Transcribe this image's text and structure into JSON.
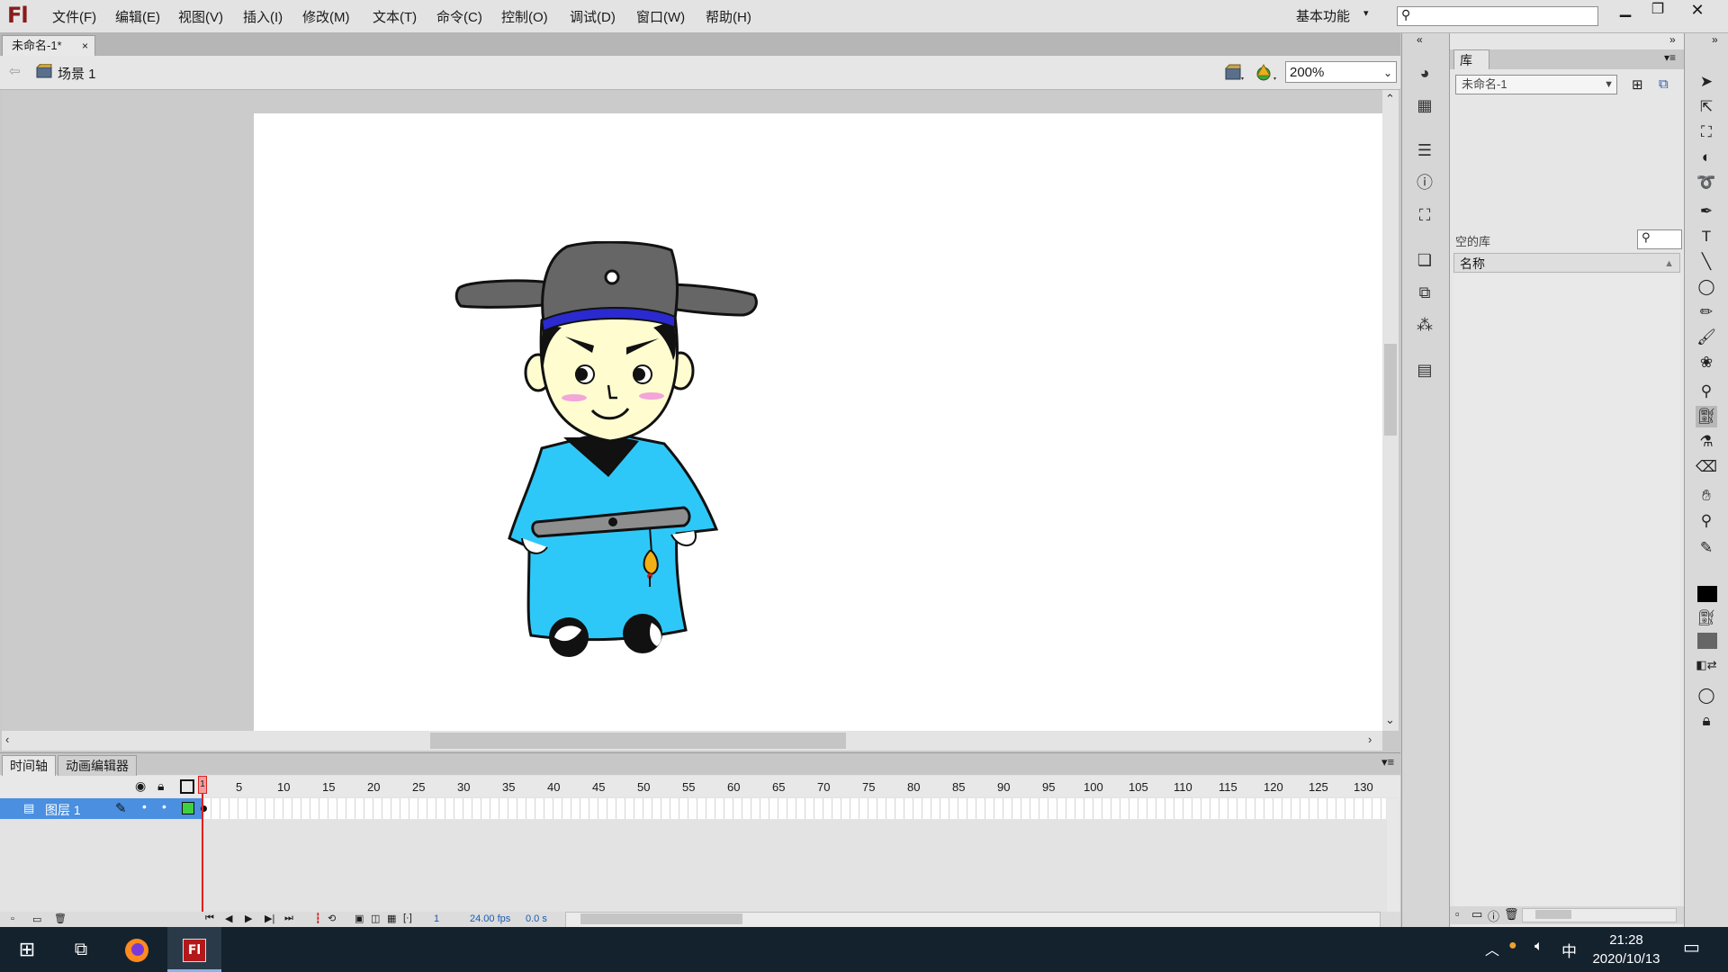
{
  "app": {
    "logo": "Fl",
    "workspace": "基本功能",
    "search_placeholder": ""
  },
  "menu": [
    "文件(F)",
    "编辑(E)",
    "视图(V)",
    "插入(I)",
    "修改(M)",
    "文本(T)",
    "命令(C)",
    "控制(O)",
    "调试(D)",
    "窗口(W)",
    "帮助(H)"
  ],
  "document": {
    "tab_title": "未命名-1*",
    "close": "×",
    "scene": "场景 1",
    "zoom": "200%"
  },
  "timeline": {
    "tabs": [
      "时间轴",
      "动画编辑器"
    ],
    "frame_numbers": [
      "1",
      "5",
      "10",
      "15",
      "20",
      "25",
      "30",
      "35",
      "40",
      "45",
      "50",
      "55",
      "60",
      "65",
      "70",
      "75",
      "80",
      "85",
      "90",
      "95",
      "100",
      "105",
      "110",
      "115",
      "120",
      "125",
      "130"
    ],
    "layer_name": "图层 1",
    "current_frame": "1",
    "fps": "24.00 fps",
    "time": "0.0 s"
  },
  "library": {
    "tab": "库",
    "doc_select": "未命名-1",
    "empty_label": "空的库",
    "column_name": "名称"
  },
  "taskbar": {
    "time": "21:28",
    "date": "2020/10/13",
    "ime": "中"
  },
  "colors": {
    "robe": "#2ec8f8",
    "face": "#fffdd0",
    "hat": "#666666",
    "headband": "#2a2ad0",
    "layer_selected": "#4a8fe0",
    "playhead": "#e02020",
    "taskbar": "#14222e"
  }
}
